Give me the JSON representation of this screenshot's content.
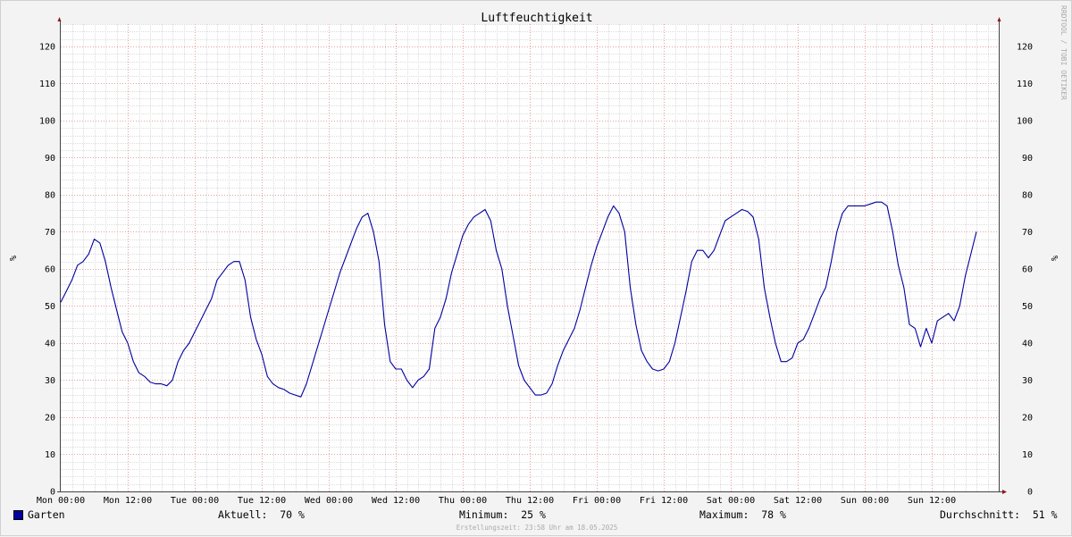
{
  "chart_data": {
    "type": "line",
    "title": "Luftfeuchtigkeit",
    "ylabel": "%",
    "ylim": [
      0,
      126
    ],
    "yticks": [
      0,
      10,
      20,
      30,
      40,
      50,
      60,
      70,
      80,
      90,
      100,
      110,
      120
    ],
    "xlim": [
      0,
      168
    ],
    "xticks": [
      {
        "x": 0,
        "label": "Mon 00:00"
      },
      {
        "x": 12,
        "label": "Mon 12:00"
      },
      {
        "x": 24,
        "label": "Tue 00:00"
      },
      {
        "x": 36,
        "label": "Tue 12:00"
      },
      {
        "x": 48,
        "label": "Wed 00:00"
      },
      {
        "x": 60,
        "label": "Wed 12:00"
      },
      {
        "x": 72,
        "label": "Thu 00:00"
      },
      {
        "x": 84,
        "label": "Thu 12:00"
      },
      {
        "x": 96,
        "label": "Fri 00:00"
      },
      {
        "x": 108,
        "label": "Fri 12:00"
      },
      {
        "x": 120,
        "label": "Sat 00:00"
      },
      {
        "x": 132,
        "label": "Sat 12:00"
      },
      {
        "x": 144,
        "label": "Sun 00:00"
      },
      {
        "x": 156,
        "label": "Sun 12:00"
      }
    ],
    "grid": true,
    "series": [
      {
        "name": "Garten",
        "color": "#0000a0",
        "points": [
          [
            0,
            51
          ],
          [
            1,
            54
          ],
          [
            2,
            57
          ],
          [
            3,
            61
          ],
          [
            4,
            62
          ],
          [
            5,
            64
          ],
          [
            6,
            68
          ],
          [
            7,
            67
          ],
          [
            8,
            62
          ],
          [
            9,
            55
          ],
          [
            10,
            49
          ],
          [
            11,
            43
          ],
          [
            12,
            40
          ],
          [
            13,
            35
          ],
          [
            14,
            32
          ],
          [
            15,
            31
          ],
          [
            16,
            29.5
          ],
          [
            17,
            29
          ],
          [
            18,
            29
          ],
          [
            19,
            28.5
          ],
          [
            20,
            30
          ],
          [
            21,
            35
          ],
          [
            22,
            38
          ],
          [
            23,
            40
          ],
          [
            24,
            43
          ],
          [
            25,
            46
          ],
          [
            26,
            49
          ],
          [
            27,
            52
          ],
          [
            28,
            57
          ],
          [
            29,
            59
          ],
          [
            30,
            61
          ],
          [
            31,
            62
          ],
          [
            32,
            62
          ],
          [
            33,
            57
          ],
          [
            34,
            47
          ],
          [
            35,
            41
          ],
          [
            36,
            37
          ],
          [
            37,
            31
          ],
          [
            38,
            29
          ],
          [
            39,
            28
          ],
          [
            40,
            27.5
          ],
          [
            41,
            26.5
          ],
          [
            42,
            26
          ],
          [
            43,
            25.5
          ],
          [
            44,
            29
          ],
          [
            45,
            34
          ],
          [
            46,
            39
          ],
          [
            47,
            44
          ],
          [
            48,
            49
          ],
          [
            49,
            54
          ],
          [
            50,
            59
          ],
          [
            51,
            63
          ],
          [
            52,
            67
          ],
          [
            53,
            71
          ],
          [
            54,
            74
          ],
          [
            55,
            75
          ],
          [
            56,
            70
          ],
          [
            57,
            62
          ],
          [
            58,
            45
          ],
          [
            59,
            35
          ],
          [
            60,
            33
          ],
          [
            61,
            33
          ],
          [
            62,
            30
          ],
          [
            63,
            28
          ],
          [
            64,
            30
          ],
          [
            65,
            31
          ],
          [
            66,
            33
          ],
          [
            67,
            44
          ],
          [
            68,
            47
          ],
          [
            69,
            52
          ],
          [
            70,
            59
          ],
          [
            71,
            64
          ],
          [
            72,
            69
          ],
          [
            73,
            72
          ],
          [
            74,
            74
          ],
          [
            75,
            75
          ],
          [
            76,
            76
          ],
          [
            77,
            73
          ],
          [
            78,
            65
          ],
          [
            79,
            60
          ],
          [
            80,
            50
          ],
          [
            81,
            42
          ],
          [
            82,
            34
          ],
          [
            83,
            30
          ],
          [
            84,
            28
          ],
          [
            85,
            26
          ],
          [
            86,
            26
          ],
          [
            87,
            26.5
          ],
          [
            88,
            29
          ],
          [
            89,
            34
          ],
          [
            90,
            38
          ],
          [
            91,
            41
          ],
          [
            92,
            44
          ],
          [
            93,
            49
          ],
          [
            94,
            55
          ],
          [
            95,
            61
          ],
          [
            96,
            66
          ],
          [
            97,
            70
          ],
          [
            98,
            74
          ],
          [
            99,
            77
          ],
          [
            100,
            75
          ],
          [
            101,
            70
          ],
          [
            102,
            55
          ],
          [
            103,
            45
          ],
          [
            104,
            38
          ],
          [
            105,
            35
          ],
          [
            106,
            33
          ],
          [
            107,
            32.5
          ],
          [
            108,
            33
          ],
          [
            109,
            35
          ],
          [
            110,
            40
          ],
          [
            111,
            47
          ],
          [
            112,
            54
          ],
          [
            113,
            62
          ],
          [
            114,
            65
          ],
          [
            115,
            65
          ],
          [
            116,
            63
          ],
          [
            117,
            65
          ],
          [
            118,
            69
          ],
          [
            119,
            73
          ],
          [
            120,
            74
          ],
          [
            121,
            75
          ],
          [
            122,
            76
          ],
          [
            123,
            75.5
          ],
          [
            124,
            74
          ],
          [
            125,
            68
          ],
          [
            126,
            55
          ],
          [
            127,
            47
          ],
          [
            128,
            40
          ],
          [
            129,
            35
          ],
          [
            130,
            35
          ],
          [
            131,
            36
          ],
          [
            132,
            40
          ],
          [
            133,
            41
          ],
          [
            134,
            44
          ],
          [
            135,
            48
          ],
          [
            136,
            52
          ],
          [
            137,
            55
          ],
          [
            138,
            62
          ],
          [
            139,
            70
          ],
          [
            140,
            75
          ],
          [
            141,
            77
          ],
          [
            142,
            77
          ],
          [
            143,
            77
          ],
          [
            144,
            77
          ],
          [
            145,
            77.5
          ],
          [
            146,
            78
          ],
          [
            147,
            78
          ],
          [
            148,
            77
          ],
          [
            149,
            70
          ],
          [
            150,
            61
          ],
          [
            151,
            55
          ],
          [
            152,
            45
          ],
          [
            153,
            44
          ],
          [
            154,
            39
          ],
          [
            155,
            44
          ],
          [
            156,
            40
          ],
          [
            157,
            46
          ],
          [
            158,
            47
          ],
          [
            159,
            48
          ],
          [
            160,
            46
          ],
          [
            161,
            50
          ],
          [
            162,
            58
          ],
          [
            163,
            64
          ],
          [
            164,
            70
          ]
        ]
      }
    ]
  },
  "watermark": "RRDTOOL / TOBI OETIKER",
  "legend": {
    "series_name": "Garten",
    "current_label": "Aktuell:",
    "current_value": "70 %",
    "min_label": "Minimum:",
    "min_value": "25 %",
    "max_label": "Maximum:",
    "max_value": "78 %",
    "avg_label": "Durchschnitt:",
    "avg_value": "51 %"
  },
  "footer": "Erstellungszeit: 23:58 Uhr am 18.05.2025"
}
